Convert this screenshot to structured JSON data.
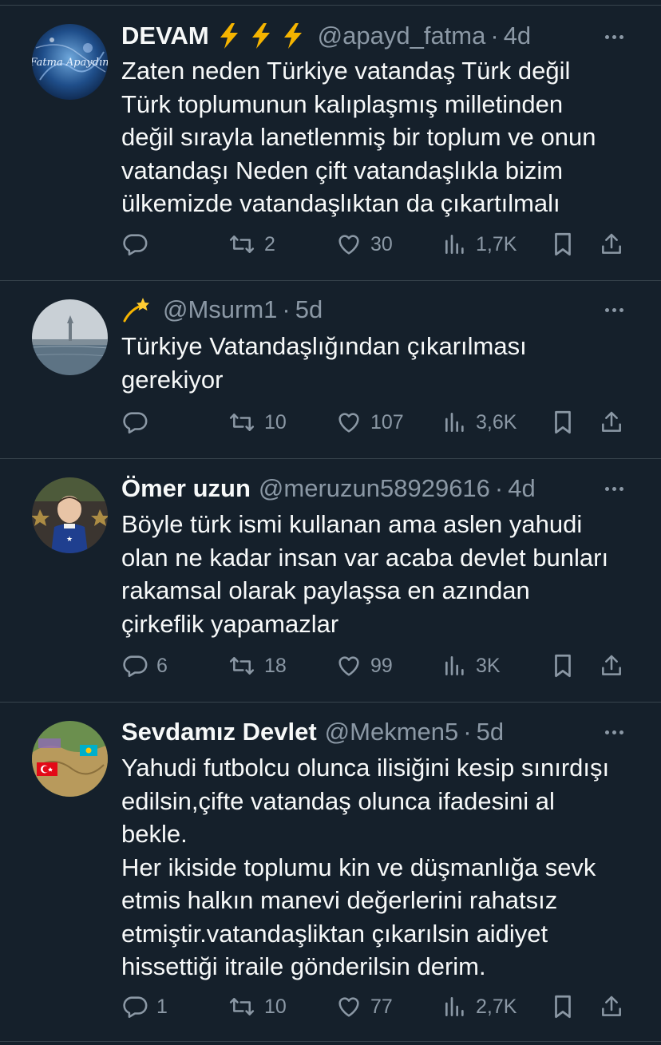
{
  "tweets": [
    {
      "name": "DEVAM",
      "handle": "@apayd_fatma",
      "time": "4d",
      "text": "Zaten neden Türkiye vatandaş Türk değil\nTürk toplumunun kalıplaşmış milletinden\ndeğil sırayla lanetlenmiş bir toplum ve onun\nvatandaşı Neden çift vatandaşlıkla bizim\nülkemizde vatandaşlıktan da çıkartılmalı",
      "avatar_text": "Fatma Apaydın",
      "replies": "",
      "reposts": "2",
      "likes": "30",
      "views": "1,7K"
    },
    {
      "name": "",
      "handle": "@Msurm1",
      "time": "5d",
      "text": "Türkiye Vatandaşlığından çıkarılması\ngerekiyor",
      "replies": "",
      "reposts": "10",
      "likes": "107",
      "views": "3,6K"
    },
    {
      "name": "Ömer uzun",
      "handle": "@meruzun58929616",
      "time": "4d",
      "text": "Böyle türk ismi kullanan ama aslen yahudi\nolan ne kadar insan var acaba devlet bunları\nrakamsal olarak paylaşsa en azından\nçirkeflik yapamazlar",
      "replies": "6",
      "reposts": "18",
      "likes": "99",
      "views": "3K"
    },
    {
      "name": "Sevdamız Devlet",
      "handle": "@Mekmen5",
      "time": "5d",
      "text": "Yahudi futbolcu olunca ilisiğini kesip sınırdışı\nedilsin,çifte vatandaş olunca ifadesini al\nbekle.\nHer ikiside toplumu kin ve düşmanlığa sevk\netmis halkın manevi değerlerini rahatsız\netmiştir.vatandaşliktan çıkarılsin aidiyet\nhissettiği itraile gönderilsin derim.",
      "replies": "1",
      "reposts": "10",
      "likes": "77",
      "views": "2,7K"
    }
  ],
  "icons": {
    "reply": "reply-icon",
    "repost": "repost-icon",
    "like": "heart-icon",
    "views": "views-icon",
    "bookmark": "bookmark-icon",
    "share": "share-icon",
    "more": "more-icon",
    "lightning": "lightning-emoji",
    "dizzy": "dizzy-emoji"
  },
  "colors": {
    "background": "#15202b",
    "text": "#f7f9f9",
    "secondary": "#8b98a5",
    "divider": "#38444d",
    "lightning": "#f5b400"
  }
}
